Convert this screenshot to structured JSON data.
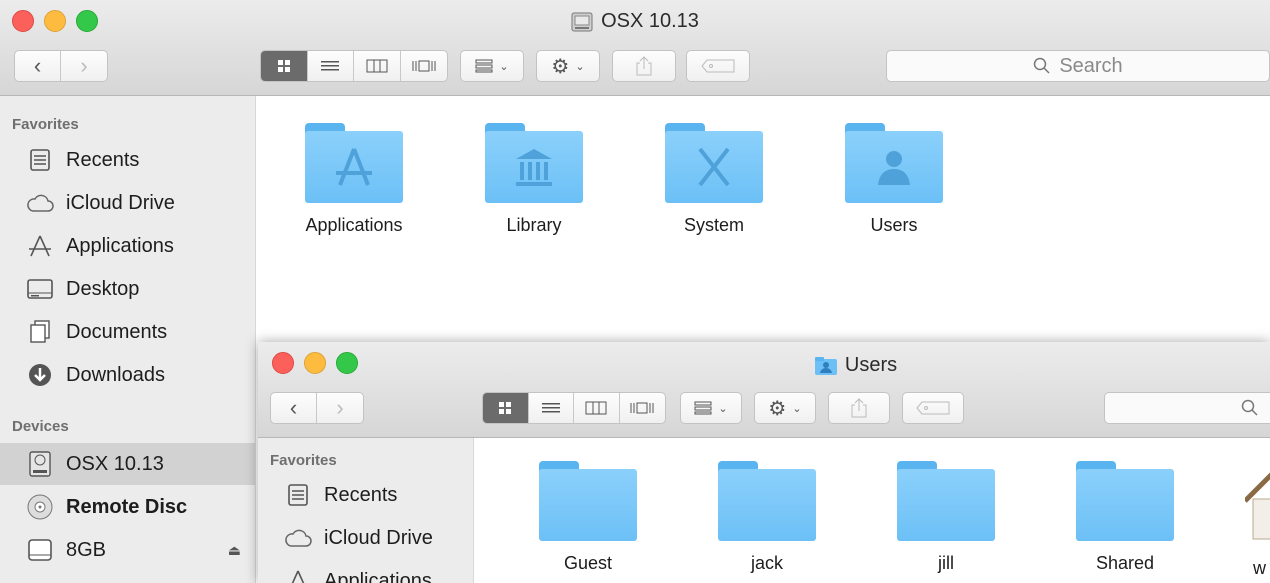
{
  "back": {
    "title": "OSX 10.13",
    "search_placeholder": "Search",
    "sidebar": {
      "favorites_heading": "Favorites",
      "favorites": [
        {
          "label": "Recents",
          "icon": "recents-icon"
        },
        {
          "label": "iCloud Drive",
          "icon": "cloud-icon"
        },
        {
          "label": "Applications",
          "icon": "applications-icon"
        },
        {
          "label": "Desktop",
          "icon": "desktop-icon"
        },
        {
          "label": "Documents",
          "icon": "documents-icon"
        },
        {
          "label": "Downloads",
          "icon": "downloads-icon"
        }
      ],
      "devices_heading": "Devices",
      "devices": [
        {
          "label": "OSX 10.13",
          "icon": "hard-drive-icon",
          "selected": true
        },
        {
          "label": "Remote Disc",
          "icon": "disc-icon"
        },
        {
          "label": "8GB",
          "icon": "usb-drive-icon"
        }
      ]
    },
    "files": [
      {
        "label": "Applications",
        "icon": "applications-folder-icon"
      },
      {
        "label": "Library",
        "icon": "library-folder-icon"
      },
      {
        "label": "System",
        "icon": "system-folder-icon"
      },
      {
        "label": "Users",
        "icon": "users-folder-icon"
      }
    ]
  },
  "front": {
    "title": "Users",
    "sidebar": {
      "favorites_heading": "Favorites",
      "favorites": [
        {
          "label": "Recents",
          "icon": "recents-icon"
        },
        {
          "label": "iCloud Drive",
          "icon": "cloud-icon"
        },
        {
          "label": "Applications",
          "icon": "applications-icon"
        }
      ]
    },
    "files": [
      {
        "label": "Guest",
        "icon": "folder-icon"
      },
      {
        "label": "jack",
        "icon": "folder-icon"
      },
      {
        "label": "jill",
        "icon": "folder-icon"
      },
      {
        "label": "Shared",
        "icon": "folder-icon"
      },
      {
        "label": "w",
        "icon": "partial-item-icon"
      }
    ]
  },
  "colors": {
    "folder": "#7ac8f8",
    "selected_sidebar": "#d2d2d2",
    "sidebar_bg": "#ececec"
  }
}
